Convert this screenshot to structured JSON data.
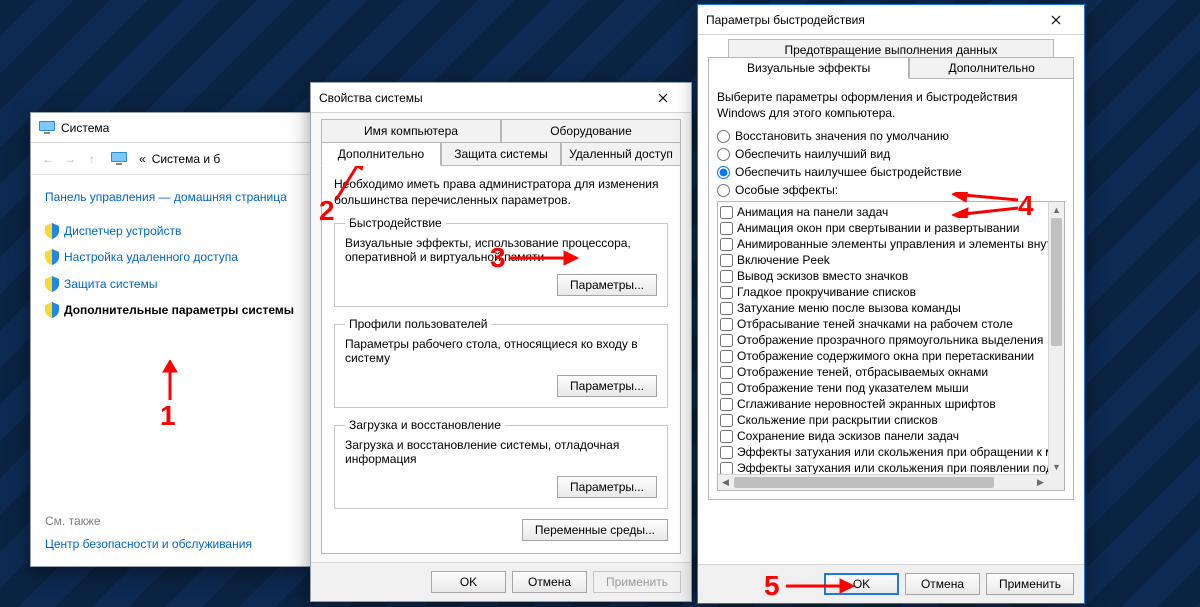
{
  "win1": {
    "title": "Система",
    "breadcrumb_prefix": "«",
    "breadcrumb": "Система и б",
    "home_link": "Панель управления — домашняя страница",
    "links": [
      "Диспетчер устройств",
      "Настройка удаленного доступа",
      "Защита системы",
      "Дополнительные параметры системы"
    ],
    "see_also": "См. также",
    "maint_link": "Центр безопасности и обслуживания"
  },
  "win2": {
    "title": "Свойства системы",
    "tabs": {
      "computer_name": "Имя компьютера",
      "hardware": "Оборудование",
      "advanced": "Дополнительно",
      "protection": "Защита системы",
      "remote": "Удаленный доступ"
    },
    "admin_note": "Необходимо иметь права администратора для изменения большинства перечисленных параметров.",
    "perf": {
      "legend": "Быстродействие",
      "desc": "Визуальные эффекты, использование процессора, оперативной и виртуальной памяти",
      "btn": "Параметры..."
    },
    "profiles": {
      "legend": "Профили пользователей",
      "desc": "Параметры рабочего стола, относящиеся ко входу в систему",
      "btn": "Параметры..."
    },
    "startup": {
      "legend": "Загрузка и восстановление",
      "desc": "Загрузка и восстановление системы, отладочная информация",
      "btn": "Параметры..."
    },
    "env_vars_btn": "Переменные среды...",
    "ok": "OK",
    "cancel": "Отмена",
    "apply": "Применить"
  },
  "win3": {
    "title": "Параметры быстродействия",
    "tabs": {
      "dep": "Предотвращение выполнения данных",
      "visual": "Визуальные эффекты",
      "advanced": "Дополнительно"
    },
    "intro": "Выберите параметры оформления и быстродействия Windows для этого компьютера.",
    "radios": [
      "Восстановить значения по умолчанию",
      "Обеспечить наилучший вид",
      "Обеспечить наилучшее быстродействие",
      "Особые эффекты:"
    ],
    "selected_radio": 2,
    "effects": [
      "Анимация на панели задач",
      "Анимация окон при свертывании и развертывании",
      "Анимированные элементы управления и элементы внутри окна",
      "Включение Peek",
      "Вывод эскизов вместо значков",
      "Гладкое прокручивание списков",
      "Затухание меню после вызова команды",
      "Отбрасывание теней значками на рабочем столе",
      "Отображение прозрачного прямоугольника выделения",
      "Отображение содержимого окна при перетаскивании",
      "Отображение теней, отбрасываемых окнами",
      "Отображение тени под указателем мыши",
      "Сглаживание неровностей экранных шрифтов",
      "Скольжение при раскрытии списков",
      "Сохранение вида эскизов панели задач",
      "Эффекты затухания или скольжения при обращении к меню",
      "Эффекты затухания или скольжения при появлении подсказок"
    ],
    "ok": "OK",
    "cancel": "Отмена",
    "apply": "Применить"
  },
  "annotations": {
    "n1": "1",
    "n2": "2",
    "n3": "3",
    "n4": "4",
    "n5": "5"
  }
}
